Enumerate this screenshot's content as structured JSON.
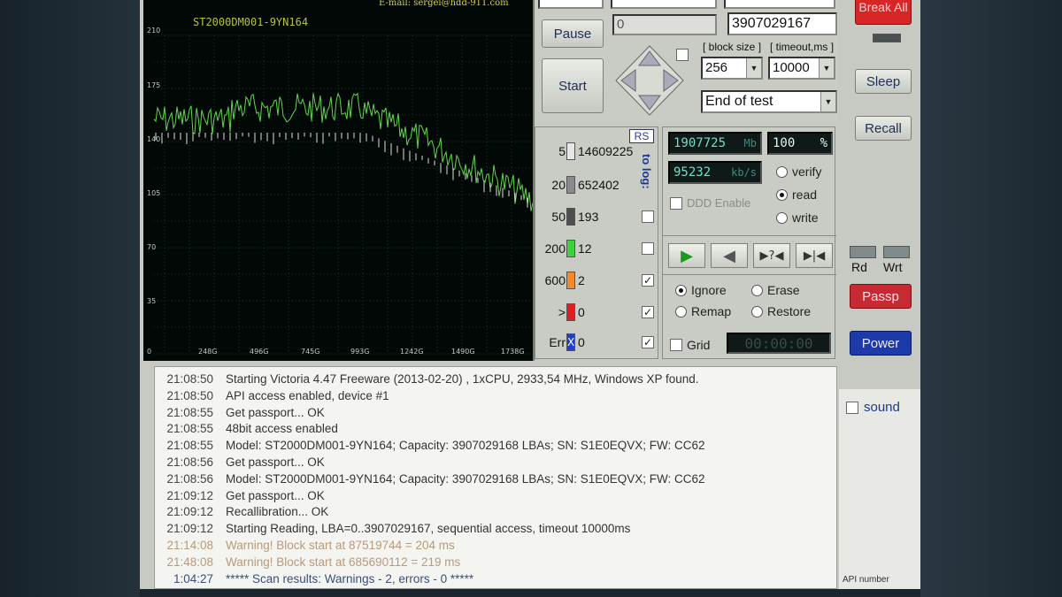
{
  "graph": {
    "model": "ST2000DM001-9YN164",
    "email": "E-mail: sergei@hdd-911.com",
    "y_ticks": [
      "210",
      "175",
      "140",
      "105",
      "70",
      "35",
      "0"
    ],
    "x_ticks": [
      "248G",
      "496G",
      "745G",
      "993G",
      "1242G",
      "1490G",
      "1738G"
    ]
  },
  "controls": {
    "start_lba": "0",
    "end_lba": "3907029167",
    "pause_label": "Pause",
    "start_label": "Start",
    "block_size_label": "block size",
    "timeout_label": "timeout,ms",
    "block_size_value": "256",
    "timeout_value": "10000",
    "end_action": "End of test",
    "break_label": "Break All"
  },
  "stats": {
    "rs_label": "RS",
    "to_log_label": "to log:",
    "rows": [
      {
        "threshold": "5",
        "count": "14609225",
        "color": "#e6e6e6",
        "logged": false
      },
      {
        "threshold": "20",
        "count": "652402",
        "color": "#8a8a8a",
        "logged": false
      },
      {
        "threshold": "50",
        "count": "193",
        "color": "#4e4e4e",
        "logged": false
      },
      {
        "threshold": "200",
        "count": "12",
        "color": "#3fd23f",
        "logged": false
      },
      {
        "threshold": "600",
        "count": "2",
        "color": "#f08a2c",
        "logged": true
      },
      {
        "threshold": ">",
        "count": "0",
        "color": "#e02020",
        "logged": true
      },
      {
        "threshold": "Err",
        "count": "0",
        "color": "#1d3fd0",
        "logged": true
      }
    ],
    "err_marker": "X"
  },
  "status": {
    "mb_value": "1907725",
    "mb_unit": "Mb",
    "percent_value": "100",
    "percent_unit": "%",
    "speed_value": "95232",
    "speed_unit": "kb/s",
    "ddd_label": "DDD Enable",
    "mode_options": [
      "verify",
      "read",
      "write"
    ],
    "mode_selected": "read",
    "action_options": [
      "Ignore",
      "Erase",
      "Remap",
      "Restore"
    ],
    "action_selected": "Ignore",
    "grid_label": "Grid",
    "timer": "00:00:00",
    "nav_buttons": [
      "▶",
      "◀",
      "▶?◀",
      "▶|◀"
    ]
  },
  "side": {
    "sleep_label": "Sleep",
    "recall_label": "Recall",
    "rd_label": "Rd",
    "wrt_label": "Wrt",
    "passp_label": "Passp",
    "power_label": "Power",
    "sound_label": "sound",
    "api_label": "API number"
  },
  "log": [
    {
      "time": "21:08:50",
      "msg": "Starting Victoria 4.47  Freeware (2013-02-20) , 1xCPU, 2933,54 MHz, Windows XP found.",
      "type": "normal"
    },
    {
      "time": "21:08:50",
      "msg": "API access enabled, device #1",
      "type": "normal"
    },
    {
      "time": "21:08:55",
      "msg": "Get passport... OK",
      "type": "normal"
    },
    {
      "time": "21:08:55",
      "msg": "48bit access enabled",
      "type": "normal"
    },
    {
      "time": "21:08:55",
      "msg": "Model: ST2000DM001-9YN164; Capacity: 3907029168 LBAs; SN: S1E0EQVX; FW: CC62",
      "type": "normal"
    },
    {
      "time": "21:08:56",
      "msg": "Get passport... OK",
      "type": "normal"
    },
    {
      "time": "21:08:56",
      "msg": "Model: ST2000DM001-9YN164; Capacity: 3907029168 LBAs; SN: S1E0EQVX; FW: CC62",
      "type": "normal"
    },
    {
      "time": "21:09:12",
      "msg": "Get passport... OK",
      "type": "normal"
    },
    {
      "time": "21:09:12",
      "msg": "Recallibration... OK",
      "type": "normal"
    },
    {
      "time": "21:09:12",
      "msg": "Starting Reading, LBA=0..3907029167, sequential access, timeout 10000ms",
      "type": "normal"
    },
    {
      "time": "21:14:08",
      "msg": "Warning! Block start at 87519744 = 204 ms",
      "type": "warn"
    },
    {
      "time": "21:48:08",
      "msg": "Warning! Block start at 685690112 = 219 ms",
      "type": "warn"
    },
    {
      "time": "1:04:27",
      "msg": "***** Scan results: Warnings - 2, errors - 0 *****",
      "type": "result"
    }
  ]
}
